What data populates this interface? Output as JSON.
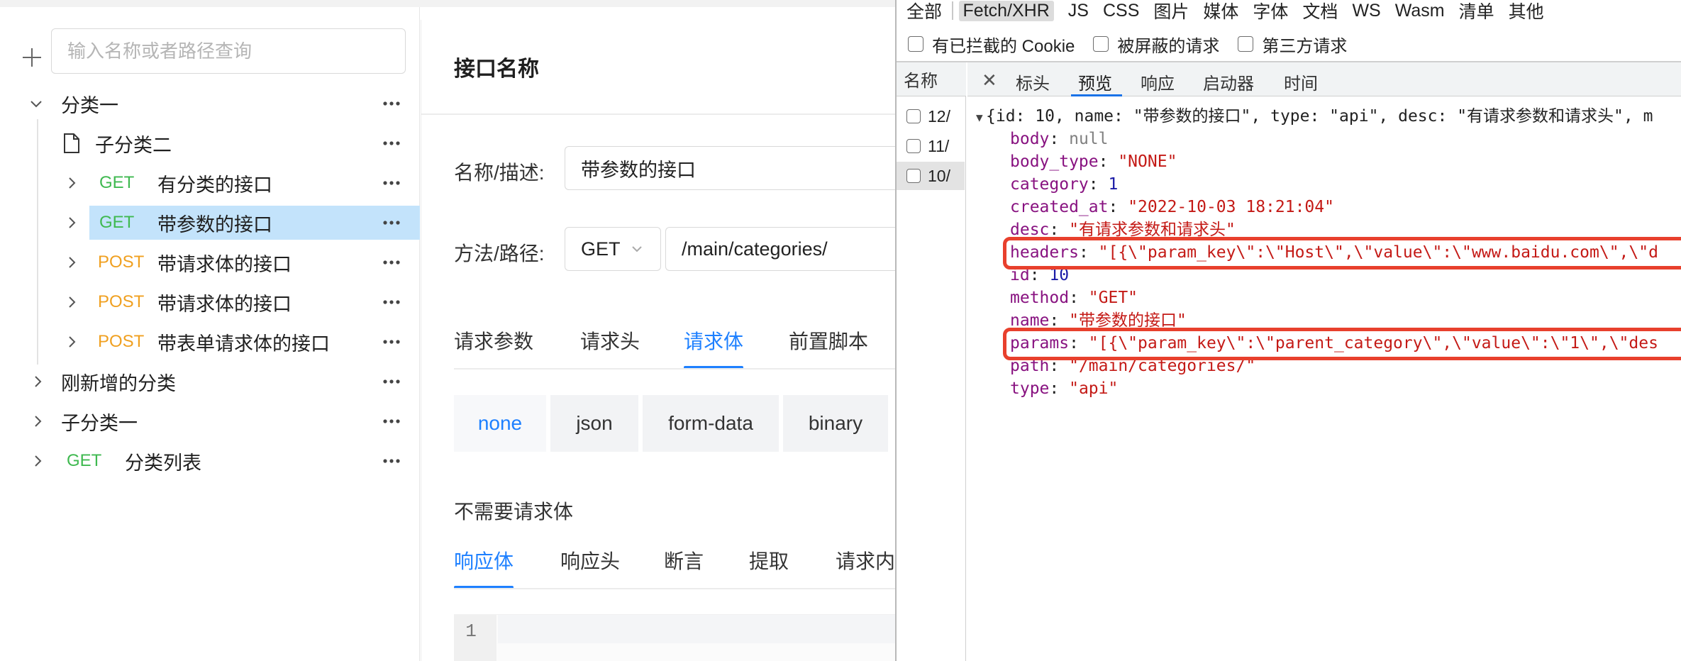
{
  "app": {
    "search": {
      "placeholder": "输入名称或者路径查询",
      "value": ""
    },
    "tree": [
      {
        "label": "分类一",
        "type": "folder",
        "expanded": true
      },
      {
        "label": "子分类二",
        "type": "doc"
      },
      {
        "method": "GET",
        "label": "有分类的接口"
      },
      {
        "method": "GET",
        "label": "带参数的接口",
        "selected": true
      },
      {
        "method": "POST",
        "label": "带请求体的接口"
      },
      {
        "method": "POST",
        "label": "带请求体的接口"
      },
      {
        "method": "POST",
        "label": "带表单请求体的接口"
      },
      {
        "label": "刚新增的分类",
        "type": "folder"
      },
      {
        "label": "子分类一",
        "type": "folder"
      },
      {
        "method": "GET",
        "label": "分类列表"
      }
    ],
    "detail": {
      "title": "接口名称",
      "name_label": "名称/描述:",
      "name_value": "带参数的接口",
      "method_label": "方法/路径:",
      "method_value": "GET",
      "path_value": "/main/categories/",
      "request_tabs": [
        "请求参数",
        "请求头",
        "请求体",
        "前置脚本"
      ],
      "active_request_tab": "请求体",
      "body_types": [
        "none",
        "json",
        "form-data",
        "binary"
      ],
      "active_body_type": "none",
      "no_body_text": "不需要请求体",
      "response_tabs": [
        "响应体",
        "响应头",
        "断言",
        "提取",
        "请求内"
      ],
      "active_response_tab": "响应体",
      "editor_line": "1"
    }
  },
  "devtools": {
    "filters": [
      "全部",
      "Fetch/XHR",
      "JS",
      "CSS",
      "图片",
      "媒体",
      "字体",
      "文档",
      "WS",
      "Wasm",
      "清单",
      "其他"
    ],
    "active_filter": "Fetch/XHR",
    "checkboxes": [
      "有已拦截的 Cookie",
      "被屏蔽的请求",
      "第三方请求"
    ],
    "name_header": "名称",
    "requests": [
      "12/",
      "11/",
      "10/"
    ],
    "selected_request": "10/",
    "detail_tabs": [
      "标头",
      "预览",
      "响应",
      "启动器",
      "时间"
    ],
    "active_detail_tab": "预览",
    "preview": {
      "summary": "{id: 10, name: \"带参数的接口\", type: \"api\", desc: \"有请求参数和请求头\", m",
      "fields": [
        {
          "key": "body",
          "value": "null",
          "kind": "null"
        },
        {
          "key": "body_type",
          "value": "\"NONE\"",
          "kind": "str"
        },
        {
          "key": "category",
          "value": "1",
          "kind": "num"
        },
        {
          "key": "created_at",
          "value": "\"2022-10-03 18:21:04\"",
          "kind": "str"
        },
        {
          "key": "desc",
          "value": "\"有请求参数和请求头\"",
          "kind": "str"
        },
        {
          "key": "headers",
          "value": "\"[{\\\"param_key\\\":\\\"Host\\\",\\\"value\\\":\\\"www.baidu.com\\\",\\\"d",
          "kind": "str",
          "highlight": true
        },
        {
          "key": "id",
          "value": "10",
          "kind": "num"
        },
        {
          "key": "method",
          "value": "\"GET\"",
          "kind": "str"
        },
        {
          "key": "name",
          "value": "\"带参数的接口\"",
          "kind": "str"
        },
        {
          "key": "params",
          "value": "\"[{\\\"param_key\\\":\\\"parent_category\\\",\\\"value\\\":\\\"1\\\",\\\"des",
          "kind": "str",
          "highlight": true
        },
        {
          "key": "path",
          "value": "\"/main/categories/\"",
          "kind": "str"
        },
        {
          "key": "type",
          "value": "\"api\"",
          "kind": "str"
        }
      ]
    },
    "colors": {
      "highlight": "#e8402d",
      "accent": "#1e80ff",
      "get": "#3fb950",
      "post": "#f0a020"
    }
  }
}
